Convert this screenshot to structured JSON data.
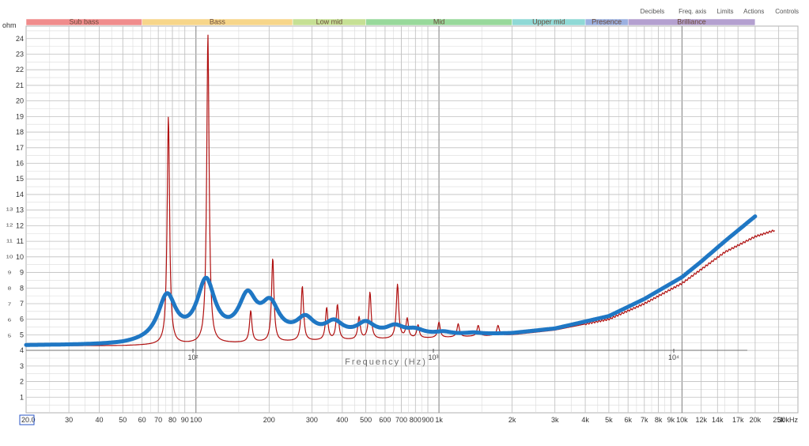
{
  "menu": [
    "Decibels",
    "Freq. axis",
    "Limits",
    "Actions",
    "Controls"
  ],
  "y_unit": "ohm",
  "colors": {
    "measured": "#b01010",
    "model": "#1f77c4",
    "grid_major": "#9a9a9a",
    "grid_minor": "#dadada"
  },
  "chart_data": {
    "type": "line",
    "xlabel": "Frequency (Hz)",
    "ylabel": "",
    "x_scale": "log",
    "xlim": [
      20,
      30000
    ],
    "ylim": [
      0,
      24.8
    ],
    "grid": true,
    "x_ticks": [
      {
        "v": 20,
        "label": "20.0"
      },
      {
        "v": 30,
        "label": "30"
      },
      {
        "v": 40,
        "label": "40"
      },
      {
        "v": 50,
        "label": "50"
      },
      {
        "v": 60,
        "label": "60"
      },
      {
        "v": 70,
        "label": "70"
      },
      {
        "v": 80,
        "label": "80"
      },
      {
        "v": 90,
        "label": "90"
      },
      {
        "v": 100,
        "label": "100"
      },
      {
        "v": 200,
        "label": "200"
      },
      {
        "v": 300,
        "label": "300"
      },
      {
        "v": 400,
        "label": "400"
      },
      {
        "v": 500,
        "label": "500"
      },
      {
        "v": 600,
        "label": "600"
      },
      {
        "v": 700,
        "label": "700"
      },
      {
        "v": 800,
        "label": "800"
      },
      {
        "v": 900,
        "label": "900"
      },
      {
        "v": 1000,
        "label": "1k"
      },
      {
        "v": 2000,
        "label": "2k"
      },
      {
        "v": 3000,
        "label": "3k"
      },
      {
        "v": 4000,
        "label": "4k"
      },
      {
        "v": 5000,
        "label": "5k"
      },
      {
        "v": 6000,
        "label": "6k"
      },
      {
        "v": 7000,
        "label": "7k"
      },
      {
        "v": 8000,
        "label": "8k"
      },
      {
        "v": 9000,
        "label": "9k"
      },
      {
        "v": 10000,
        "label": "10k"
      },
      {
        "v": 12000,
        "label": "12k"
      },
      {
        "v": 14000,
        "label": "14k"
      },
      {
        "v": 17000,
        "label": "17k"
      },
      {
        "v": 20000,
        "label": "20k"
      },
      {
        "v": 25000,
        "label": "25k"
      },
      {
        "v": 30000,
        "label": "30kHz"
      }
    ],
    "y_ticks": [
      1,
      2,
      3,
      4,
      5,
      6,
      7,
      8,
      9,
      10,
      11,
      12,
      13,
      14,
      15,
      16,
      17,
      18,
      19,
      20,
      21,
      22,
      23,
      24
    ],
    "overlay_x_ticks": [
      {
        "v": 100,
        "label": "10²"
      },
      {
        "v": 1000,
        "label": "10³"
      },
      {
        "v": 10000,
        "label": "10⁴"
      }
    ],
    "overlay_y_ticks": [
      5,
      6,
      7,
      8,
      9,
      10,
      11,
      12,
      13
    ],
    "bands": [
      {
        "name": "Sub bass",
        "from": 20,
        "to": 60,
        "color": "#f08c8c"
      },
      {
        "name": "Bass",
        "from": 60,
        "to": 250,
        "color": "#f7d68a"
      },
      {
        "name": "Low mid",
        "from": 250,
        "to": 500,
        "color": "#c6e094"
      },
      {
        "name": "Mid",
        "from": 500,
        "to": 2000,
        "color": "#98d99b"
      },
      {
        "name": "Upper mid",
        "from": 2000,
        "to": 4000,
        "color": "#8fd9d6"
      },
      {
        "name": "Presence",
        "from": 4000,
        "to": 6000,
        "color": "#9bb0e0"
      },
      {
        "name": "Brilliance",
        "from": 6000,
        "to": 20000,
        "color": "#b4a0d0"
      }
    ],
    "series": [
      {
        "name": "",
        "style": "measured",
        "baseline": [
          [
            20,
            4.3
          ],
          [
            50,
            4.3
          ],
          [
            100,
            4.4
          ],
          [
            300,
            4.6
          ],
          [
            1000,
            4.8
          ],
          [
            2000,
            5.0
          ],
          [
            3000,
            5.3
          ],
          [
            5000,
            6.0
          ],
          [
            7000,
            7.0
          ],
          [
            10000,
            8.3
          ],
          [
            12000,
            9.2
          ],
          [
            15000,
            10.3
          ],
          [
            20000,
            11.3
          ],
          [
            24000,
            11.7
          ]
        ],
        "peaks": [
          [
            77,
            19.0
          ],
          [
            112,
            24.3
          ],
          [
            168,
            6.5
          ],
          [
            207,
            9.9
          ],
          [
            274,
            8.1
          ],
          [
            345,
            6.7
          ],
          [
            382,
            6.9
          ],
          [
            469,
            6.1
          ],
          [
            520,
            7.7
          ],
          [
            675,
            8.2
          ],
          [
            740,
            6.0
          ],
          [
            820,
            5.6
          ],
          [
            1000,
            5.8
          ],
          [
            1200,
            5.7
          ],
          [
            1450,
            5.6
          ],
          [
            1750,
            5.6
          ]
        ],
        "peak_width": 0.006
      },
      {
        "name": "",
        "style": "model",
        "baseline": [
          [
            20,
            4.3
          ],
          [
            50,
            4.3
          ],
          [
            100,
            4.5
          ],
          [
            300,
            4.7
          ],
          [
            1000,
            4.9
          ],
          [
            2000,
            5.1
          ],
          [
            3000,
            5.4
          ],
          [
            5000,
            6.2
          ],
          [
            7000,
            7.3
          ],
          [
            10000,
            8.7
          ],
          [
            12000,
            9.7
          ],
          [
            15000,
            11.0
          ],
          [
            20000,
            12.6
          ]
        ],
        "peaks": [
          [
            76,
            7.3
          ],
          [
            110,
            8.2
          ],
          [
            163,
            7.1
          ],
          [
            202,
            6.6
          ],
          [
            282,
            5.8
          ],
          [
            370,
            5.6
          ],
          [
            500,
            5.6
          ],
          [
            660,
            5.4
          ],
          [
            800,
            5.2
          ],
          [
            1050,
            5.1
          ],
          [
            1400,
            5.1
          ]
        ],
        "peak_width": 0.045
      }
    ]
  }
}
